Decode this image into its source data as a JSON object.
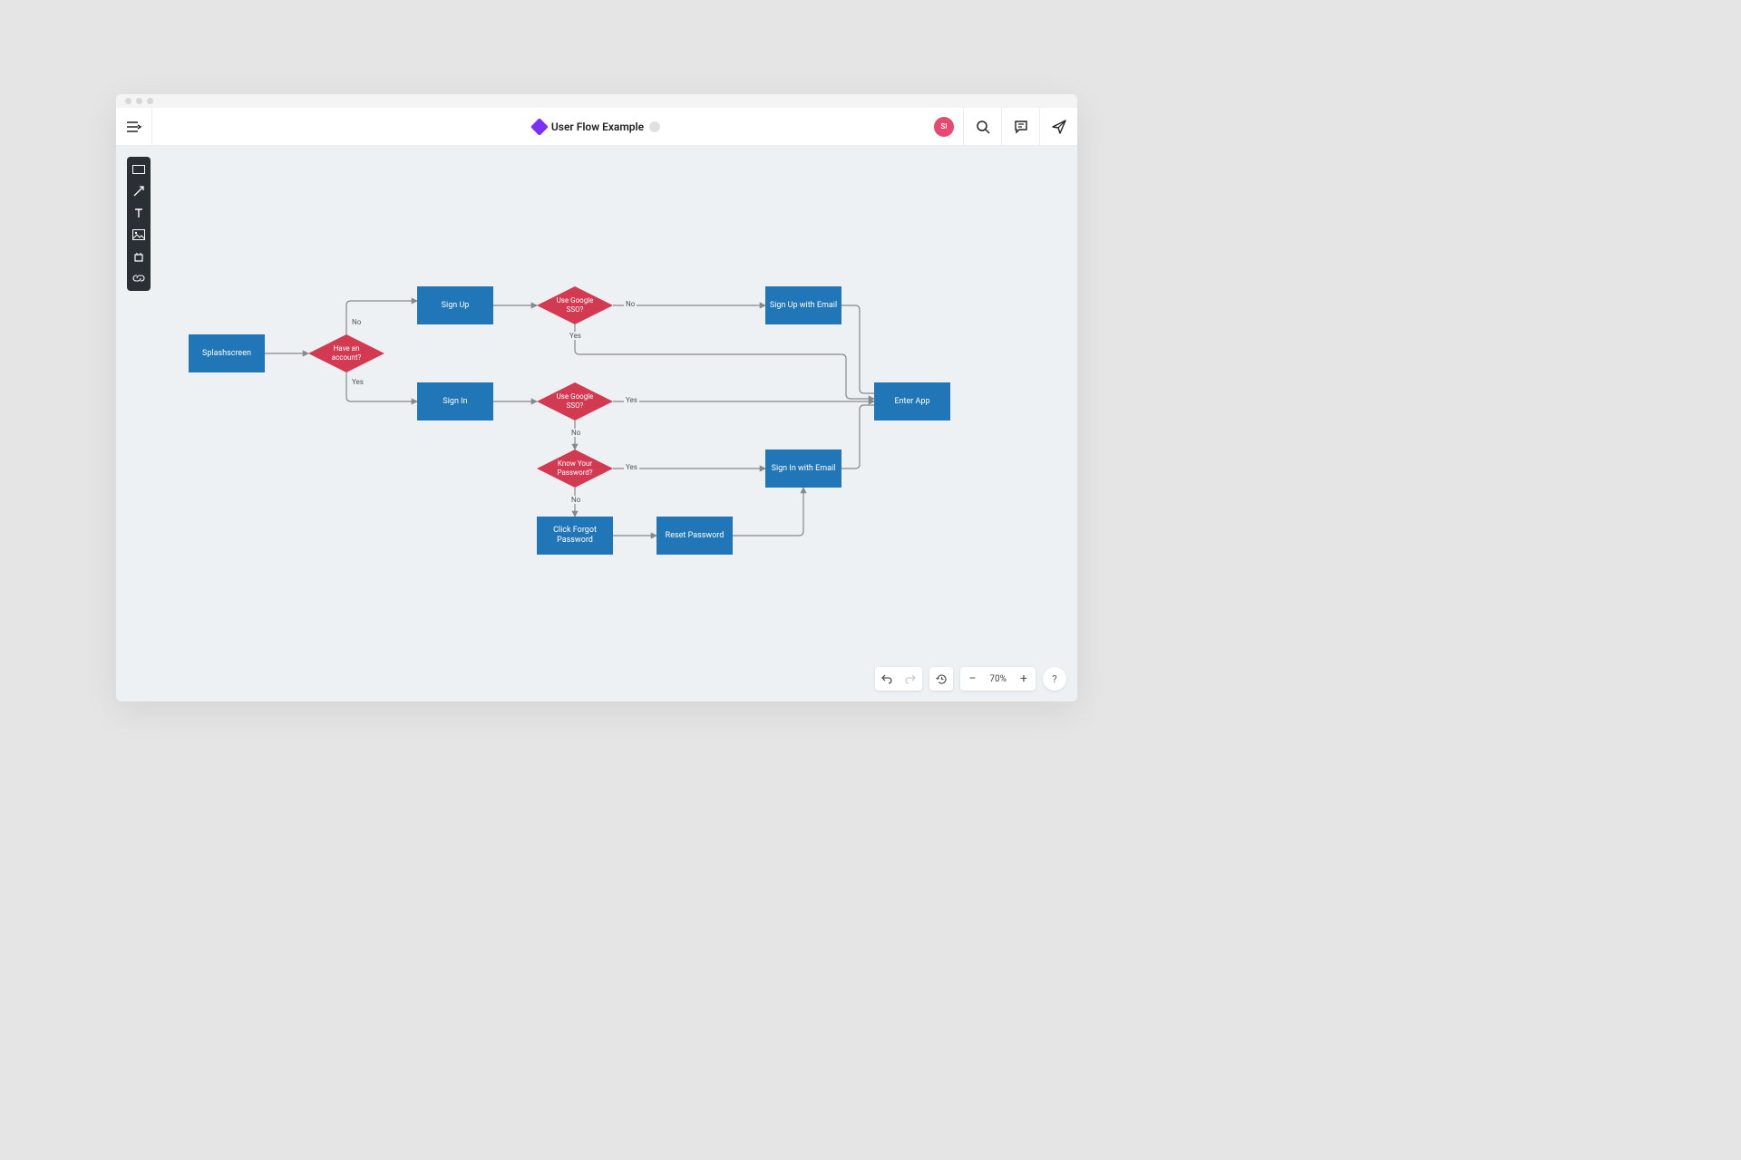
{
  "header": {
    "title": "User Flow Example",
    "avatar_initials": "SI"
  },
  "controls": {
    "zoom_label": "70%"
  },
  "flow": {
    "nodes": {
      "splash": {
        "type": "rect",
        "label": "Splashscreen"
      },
      "have_acct": {
        "type": "diamond",
        "label": "Have an account?"
      },
      "sign_up": {
        "type": "rect",
        "label": "Sign Up"
      },
      "sign_in": {
        "type": "rect",
        "label": "Sign In"
      },
      "sso_up": {
        "type": "diamond",
        "label": "Use Google SSO?"
      },
      "sso_in": {
        "type": "diamond",
        "label": "Use Google SSO?"
      },
      "signup_email": {
        "type": "rect",
        "label": "Sign Up with Email"
      },
      "know_pw": {
        "type": "diamond",
        "label": "Know Your Password?"
      },
      "signin_email": {
        "type": "rect",
        "label": "Sign In with Email"
      },
      "forgot": {
        "type": "rect",
        "label": "Click Forgot Password"
      },
      "reset": {
        "type": "rect",
        "label": "Reset Password"
      },
      "enter": {
        "type": "rect",
        "label": "Enter App"
      }
    },
    "edge_labels": {
      "acct_no": "No",
      "acct_yes": "Yes",
      "sso_up_no": "No",
      "sso_up_yes": "Yes",
      "sso_in_yes": "Yes",
      "sso_in_no": "No",
      "pw_yes": "Yes",
      "pw_no": "No"
    }
  }
}
